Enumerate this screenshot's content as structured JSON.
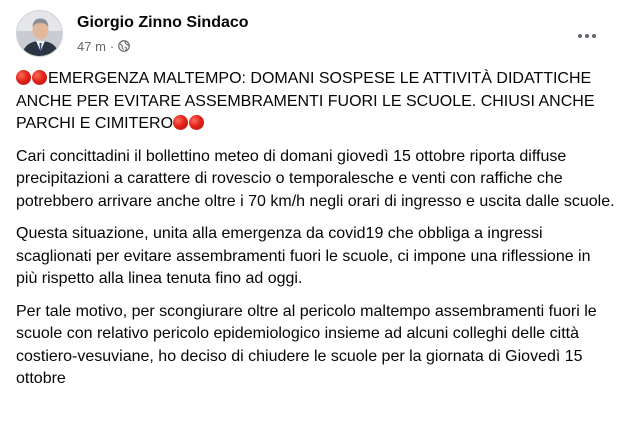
{
  "post": {
    "author": "Giorgio Zinno Sindaco",
    "timestamp": "47 m",
    "separator": "·",
    "privacy_icon": "globe-icon",
    "options_icon": "more-options-icon",
    "headline": {
      "prefix_emoji": [
        "red-circle-emoji",
        "red-circle-emoji"
      ],
      "text": "EMERGENZA MALTEMPO: DOMANI SOSPESE LE ATTIVITÀ DIDATTICHE ANCHE PER EVITARE ASSEMBRAMENTI FUORI LE SCUOLE. CHIUSI ANCHE PARCHI E CIMITERO",
      "suffix_emoji": [
        "red-circle-emoji",
        "red-circle-emoji"
      ]
    },
    "paragraphs": [
      "Cari concittadini il bollettino meteo di domani giovedì 15 ottobre riporta diffuse precipitazioni a carattere di rovescio o temporalesche e venti con raffiche che potrebbero arrivare anche oltre i 70 km/h negli orari di ingresso e uscita dalle scuole.",
      "Questa situazione, unita alla emergenza da covid19 che obbliga a ingressi scaglionati per evitare assembramenti fuori le scuole, ci impone una riflessione in più rispetto alla linea tenuta fino ad oggi.",
      "Per tale motivo, per scongiurare oltre al pericolo maltempo assembramenti fuori le scuole con relativo pericolo epidemiologico insieme ad alcuni colleghi delle città costiero-vesuviane, ho deciso di chiudere le scuole per la giornata di Giovedì 15 ottobre"
    ]
  },
  "colors": {
    "text_primary": "#050505",
    "text_secondary": "#65676b",
    "background": "#ffffff",
    "emoji_red": "#e2231a"
  }
}
